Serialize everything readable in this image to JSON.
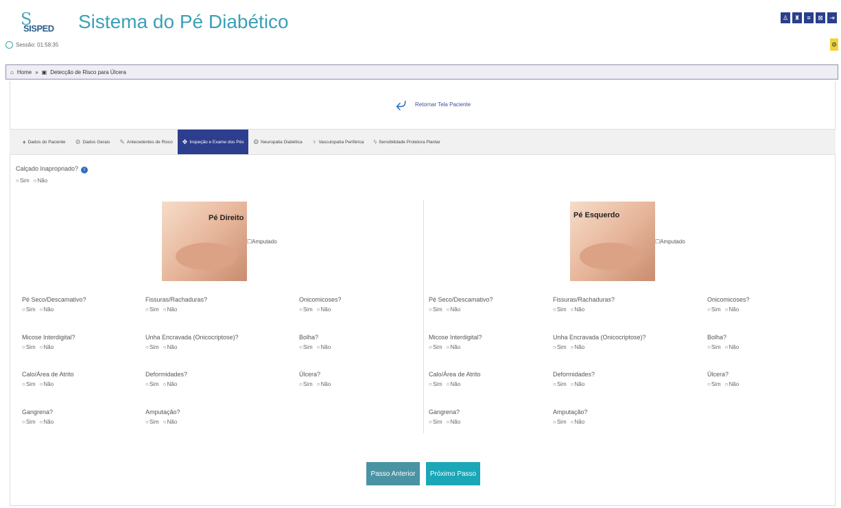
{
  "header": {
    "logo_text": "SISPED",
    "title": "Sistema do Pé Diabético",
    "session": "Sessão: 01:58:35",
    "top_icons": [
      "♙",
      "♜",
      "≡",
      "⊠",
      "⇥"
    ]
  },
  "breadcrumb": {
    "home": "Home",
    "current": "Detecção de Risco para Úlcera"
  },
  "return_link": "Retornar Tela Paciente",
  "tabs": [
    {
      "icon": "♦",
      "label": "Dados do Paciente"
    },
    {
      "icon": "⚙",
      "label": "Dados Gerais"
    },
    {
      "icon": "✎",
      "label": "Antecedentes de Risco"
    },
    {
      "icon": "✥",
      "label": "Inspeção e Exame dos Pés"
    },
    {
      "icon": "❂",
      "label": "Neuropatia Diabética"
    },
    {
      "icon": "♆",
      "label": "Vasculopatia Periférica"
    },
    {
      "icon": "ϟ",
      "label": "Sensibilidade Protetora Plantar"
    }
  ],
  "top_question": {
    "label": "Calçado Inapropriado?",
    "options": [
      "Sim",
      "Não"
    ]
  },
  "right_foot": {
    "title": "Pé Direito",
    "amputado": "Amputado"
  },
  "left_foot": {
    "title": "Pé Esquerdo",
    "amputado": "Amputado"
  },
  "questions": [
    {
      "label": "Pé Seco/Descamativo?"
    },
    {
      "label": "Fissuras/Rachaduras?"
    },
    {
      "label": "Onicomicoses?"
    },
    {
      "label": "Micose Interdigital?"
    },
    {
      "label": "Unha Encravada (Onicocriptose)?"
    },
    {
      "label": "Bolha?"
    },
    {
      "label": "Calo/Área de Atrito"
    },
    {
      "label": "Deformidades?"
    },
    {
      "label": "Úlcera?"
    },
    {
      "label": "Gangrena?"
    },
    {
      "label": "Amputação?"
    }
  ],
  "options": [
    "Sim",
    "Não"
  ],
  "buttons": {
    "prev": "Passo Anterior",
    "next": "Próximo Passo"
  }
}
